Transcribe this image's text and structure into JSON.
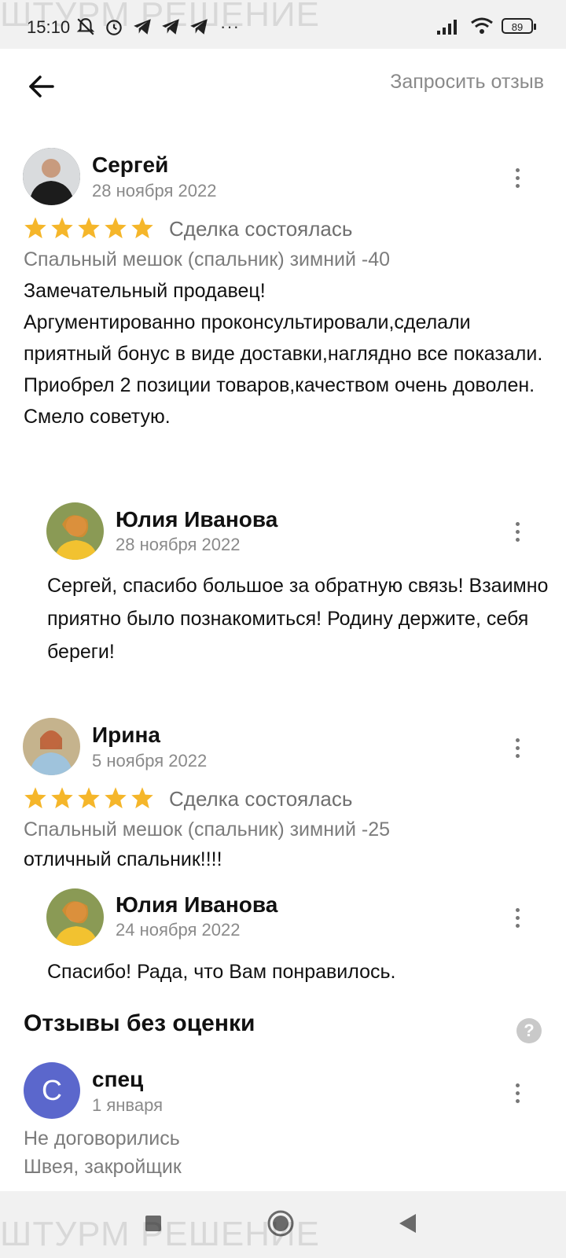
{
  "status_bar": {
    "time": "15:10",
    "icons": [
      "mute-icon",
      "alarm-icon",
      "telegram-icon",
      "telegram-icon",
      "telegram-icon"
    ],
    "more": "···",
    "battery": "89"
  },
  "watermark": "ШТУРМ РЕШЕНИЕ",
  "header": {
    "request_review_label": "Запросить отзыв"
  },
  "reviews": [
    {
      "author": "Сергей",
      "date": "28 ноября 2022",
      "rating": 5,
      "deal_status": "Сделка состоялась",
      "product": "Спальный мешок (спальник) зимний -40",
      "text": "Замечательный продавец!\nАргументированно проконсультировали,сделали приятный бонус в виде доставки,наглядно все показали.\nПриобрел 2 позиции товаров,качеством очень доволен.\nСмело советую.",
      "reply": {
        "author": "Юлия Иванова",
        "date": "28 ноября 2022",
        "text": "Сергей, спасибо большое за обратную связь! Взаимно приятно было познакомиться! Родину держите, себя береги!"
      }
    },
    {
      "author": "Ирина",
      "date": "5 ноября 2022",
      "rating": 5,
      "deal_status": "Сделка состоялась",
      "product": "Спальный мешок (спальник) зимний -25",
      "text": "отличный спальник!!!!",
      "reply": {
        "author": "Юлия Иванова",
        "date": "24 ноября 2022",
        "text": "Спасибо! Рада, что Вам понравилось."
      }
    }
  ],
  "unrated_section": {
    "title": "Отзывы без оценки",
    "items": [
      {
        "avatar_letter": "С",
        "author": "спец",
        "date": "1 января",
        "deal_status": "Не договорились",
        "category": "Швея, закройщик"
      }
    ]
  },
  "colors": {
    "star": "#f5b62a",
    "letter_avatar": "#5b67cc",
    "muted_text": "#8a8a8a"
  }
}
